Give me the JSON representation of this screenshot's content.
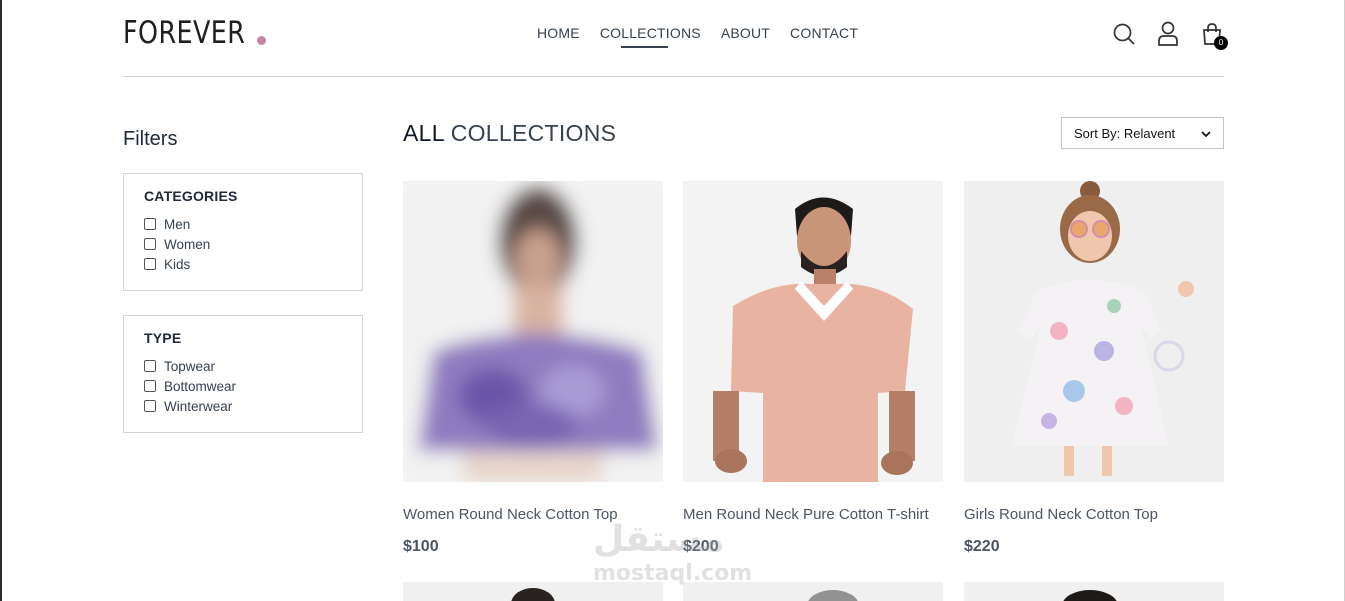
{
  "brand": {
    "name": "FOREVER",
    "dot_color": "#c586a5"
  },
  "nav": {
    "links": [
      "HOME",
      "COLLECTIONS",
      "ABOUT",
      "CONTACT"
    ],
    "active": "COLLECTIONS",
    "icons": [
      "search-icon",
      "profile-icon",
      "cart-icon"
    ],
    "cart_count": "0"
  },
  "filters": {
    "title": "Filters",
    "categories": {
      "heading": "CATEGORIES",
      "options": [
        "Men",
        "Women",
        "Kids"
      ]
    },
    "type": {
      "heading": "TYPE",
      "options": [
        "Topwear",
        "Bottomwear",
        "Winterwear"
      ]
    }
  },
  "main": {
    "title_part1": "ALL",
    "title_part2": "COLLECTIONS",
    "sort": {
      "selected": "Sort By: Relavent"
    }
  },
  "products": [
    {
      "name": "Women Round Neck Cotton Top",
      "price": "$100"
    },
    {
      "name": "Men Round Neck Pure Cotton T-shirt",
      "price": "$200"
    },
    {
      "name": "Girls Round Neck Cotton Top",
      "price": "$220"
    }
  ],
  "watermark": {
    "arabic": "مستقل",
    "latin": "mostaql.com"
  }
}
